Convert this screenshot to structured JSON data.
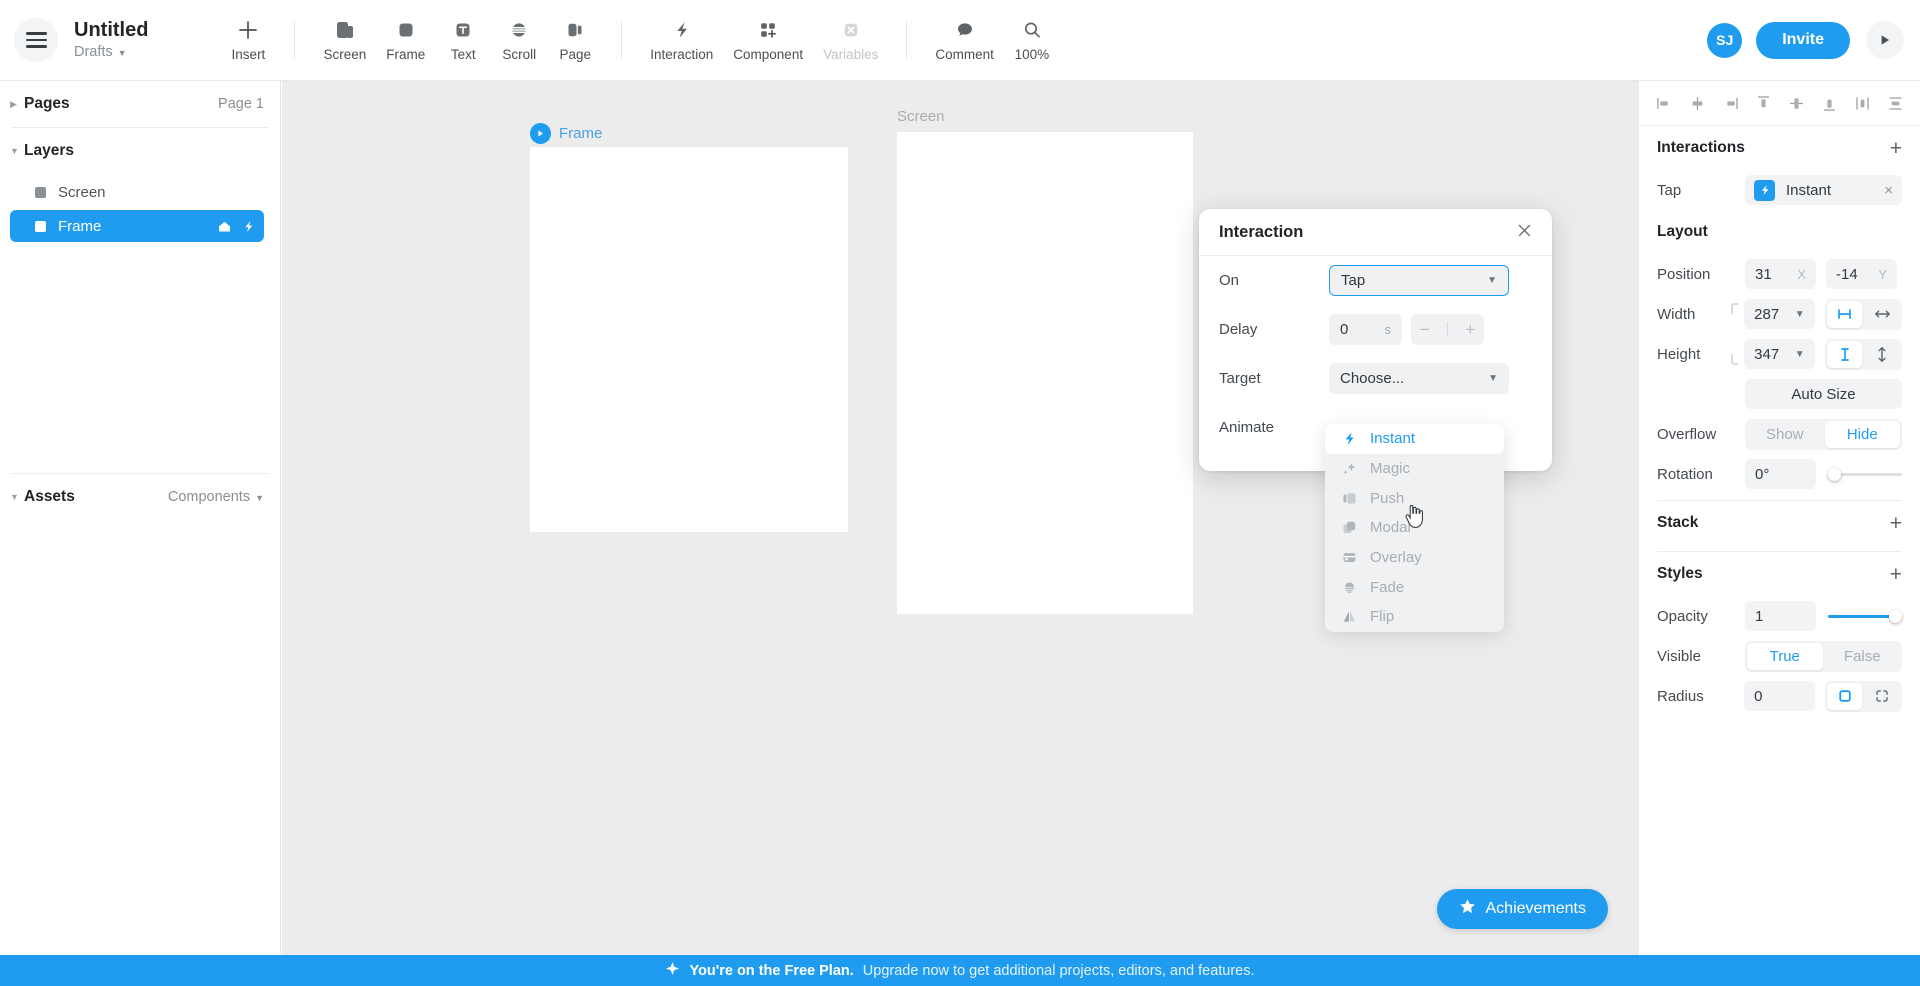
{
  "topbar": {
    "menu_icon": "hamburger-icon",
    "title": "Untitled",
    "subtitle": "Drafts",
    "tools": [
      {
        "label": "Insert",
        "icon": "plus-icon",
        "dim": false
      },
      {
        "label": "Screen",
        "icon": "screen-icon",
        "dim": false
      },
      {
        "label": "Frame",
        "icon": "frame-icon",
        "dim": false
      },
      {
        "label": "Text",
        "icon": "text-icon",
        "dim": false
      },
      {
        "label": "Scroll",
        "icon": "scroll-icon",
        "dim": false
      },
      {
        "label": "Page",
        "icon": "page-icon",
        "dim": false
      },
      {
        "label": "Interaction",
        "icon": "bolt-icon",
        "dim": false
      },
      {
        "label": "Component",
        "icon": "component-icon",
        "dim": false
      },
      {
        "label": "Variables",
        "icon": "variables-icon",
        "dim": true
      },
      {
        "label": "Comment",
        "icon": "comment-icon",
        "dim": false
      },
      {
        "label": "100%",
        "icon": "zoom-icon",
        "dim": false
      }
    ],
    "avatar_initials": "SJ",
    "invite_label": "Invite",
    "preview_icon": "play-icon"
  },
  "left_panel": {
    "pages": {
      "title": "Pages",
      "value": "Page 1"
    },
    "layers": {
      "title": "Layers",
      "items": [
        {
          "name": "Screen",
          "selected": false,
          "icons": []
        },
        {
          "name": "Frame",
          "selected": true,
          "icons": [
            "home-icon",
            "bolt-icon"
          ]
        }
      ]
    },
    "assets": {
      "title": "Assets",
      "value": "Components"
    }
  },
  "canvas": {
    "frame_label": "Frame",
    "screen_label": "Screen"
  },
  "dialog": {
    "title": "Interaction",
    "close_icon": "close-icon",
    "rows": {
      "on_label": "On",
      "on_value": "Tap",
      "delay_label": "Delay",
      "delay_value": "0",
      "delay_unit": "s",
      "minus": "−",
      "plus": "+",
      "target_label": "Target",
      "target_value": "Choose...",
      "animate_label": "Animate"
    },
    "animate_options": [
      {
        "label": "Instant",
        "icon": "bolt-icon",
        "active": true
      },
      {
        "label": "Magic",
        "icon": "sparkle-icon",
        "active": false
      },
      {
        "label": "Push",
        "icon": "push-icon",
        "active": false
      },
      {
        "label": "Modal",
        "icon": "modal-icon",
        "active": false
      },
      {
        "label": "Overlay",
        "icon": "overlay-icon",
        "active": false
      },
      {
        "label": "Fade",
        "icon": "fade-icon",
        "active": false
      },
      {
        "label": "Flip",
        "icon": "flip-icon",
        "active": false
      }
    ]
  },
  "right_panel": {
    "align_icons": [
      "align-left-icon",
      "align-center-horizontal-icon",
      "align-right-icon",
      "align-top-icon",
      "align-middle-vertical-icon",
      "align-bottom-icon",
      "distribute-horizontal-icon",
      "distribute-vertical-icon"
    ],
    "interactions": {
      "title": "Interactions",
      "add": "+",
      "row_label": "Tap",
      "row_value": "Instant",
      "remove": "×"
    },
    "layout": {
      "title": "Layout",
      "position_label": "Position",
      "position_x": "31",
      "position_x_suffix": "X",
      "position_y": "-14",
      "position_y_suffix": "Y",
      "width_label": "Width",
      "width_value": "287",
      "height_label": "Height",
      "height_value": "347",
      "auto_size": "Auto Size",
      "overflow_label": "Overflow",
      "overflow_show": "Show",
      "overflow_hide": "Hide",
      "overflow_selected": "Hide",
      "rotation_label": "Rotation",
      "rotation_value": "0°"
    },
    "stack": {
      "title": "Stack",
      "add": "+"
    },
    "styles": {
      "title": "Styles",
      "add": "+",
      "opacity_label": "Opacity",
      "opacity_value": "1",
      "visible_label": "Visible",
      "visible_true": "True",
      "visible_false": "False",
      "visible_selected": "True",
      "radius_label": "Radius",
      "radius_value": "0"
    }
  },
  "achievements": {
    "label": "Achievements",
    "icon": "star-icon"
  },
  "banner": {
    "icon": "sparkle-icon",
    "bold_text": "You're on the Free Plan.",
    "rest_text": "Upgrade now to get additional projects, editors, and features."
  },
  "colors": {
    "accent": "#1f9cf0",
    "canvas": "#ececec",
    "panel": "#ffffff",
    "muted": "#a9adb1"
  }
}
